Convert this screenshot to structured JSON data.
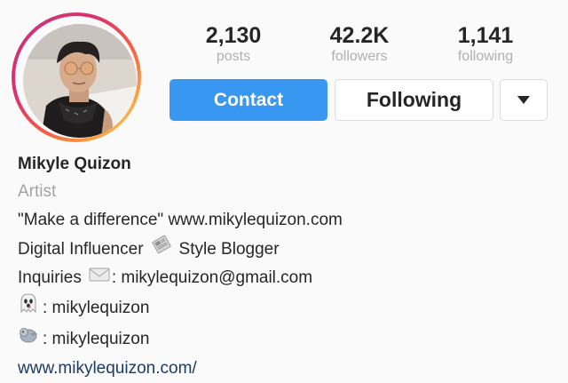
{
  "profile": {
    "posts": {
      "value": "2,130",
      "label": "posts"
    },
    "followers": {
      "value": "42.2K",
      "label": "followers"
    },
    "following": {
      "value": "1,141",
      "label": "following"
    }
  },
  "actions": {
    "contact_label": "Contact",
    "following_label": "Following"
  },
  "bio": {
    "name": "Mikyle Quizon",
    "category": "Artist",
    "quote_line": "\"Make a difference\" www.mikylequizon.com",
    "influencer_part1": "Digital Influencer",
    "influencer_part2": "Style Blogger",
    "inquiries_label": "Inquiries",
    "inquiries_email": ": mikylequizon@gmail.com",
    "snapchat_handle": ": mikylequizon",
    "twitter_handle": ": mikylequizon",
    "website": "www.mikylequizon.com/"
  },
  "icons": {
    "newspaper": "newspaper-emoji",
    "envelope": "envelope-emoji",
    "ghost": "ghost-emoji",
    "bird": "bird-emoji",
    "dropdown": "triangle-down-icon"
  },
  "colors": {
    "contact_button": "#3897f0",
    "link": "#1c3b66",
    "muted": "#a3a3a3"
  }
}
